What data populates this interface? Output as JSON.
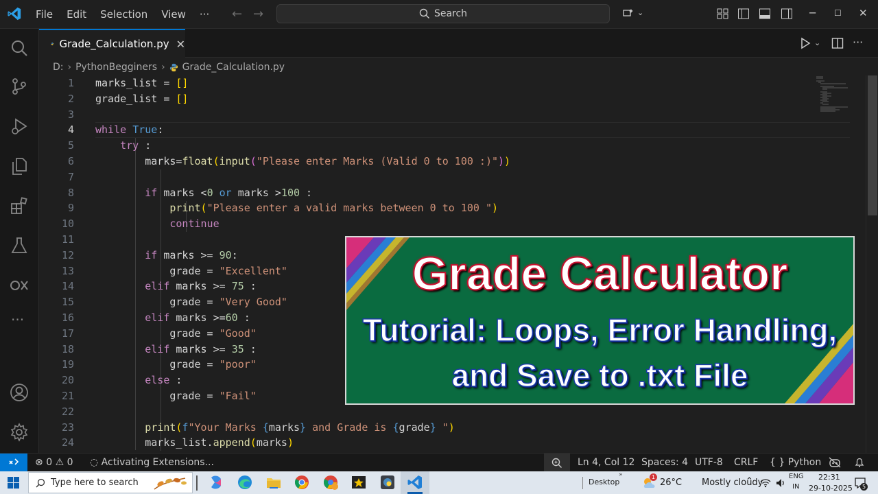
{
  "titlebar": {
    "menu": [
      "File",
      "Edit",
      "Selection",
      "View",
      "···"
    ],
    "search_label": "Search"
  },
  "tab": {
    "filename": "Grade_Calculation.py",
    "close_glyph": "✕"
  },
  "breadcrumb": [
    "D:",
    "PythonBegginers",
    "Grade_Calculation.py"
  ],
  "editor": {
    "current_line": 4,
    "lines": [
      {
        "no": "1",
        "html": "<span class=\"v\">marks_list = </span><span class=\"y\">[]</span>"
      },
      {
        "no": "2",
        "html": "<span class=\"v\">grade_list = </span><span class=\"y\">[]</span>"
      },
      {
        "no": "3",
        "html": ""
      },
      {
        "no": "4",
        "html": "<span class=\"k\">while</span> <span class=\"b\">True</span><span class=\"v\">:</span>"
      },
      {
        "no": "5",
        "html": "    <span class=\"k\">try</span><span class=\"v\"> :</span>"
      },
      {
        "no": "6",
        "html": "        <span class=\"v\">marks=</span><span class=\"f\">float</span><span class=\"y\">(</span><span class=\"f\">input</span><span class=\"p\">(</span><span class=\"s\">\"Please enter Marks (Valid 0 to 100 :)\"</span><span class=\"p\">)</span><span class=\"y\">)</span>"
      },
      {
        "no": "7",
        "html": ""
      },
      {
        "no": "8",
        "html": "        <span class=\"k\">if</span><span class=\"v\"> marks &lt;</span><span class=\"n\">0</span> <span class=\"b\">or</span><span class=\"v\"> marks &gt;</span><span class=\"n\">100</span><span class=\"v\"> :</span>"
      },
      {
        "no": "9",
        "html": "            <span class=\"f\">print</span><span class=\"y\">(</span><span class=\"s\">\"Please enter a valid marks between 0 to 100 \"</span><span class=\"y\">)</span>"
      },
      {
        "no": "10",
        "html": "            <span class=\"k\">continue</span>"
      },
      {
        "no": "11",
        "html": ""
      },
      {
        "no": "12",
        "html": "        <span class=\"k\">if</span><span class=\"v\"> marks &gt;= </span><span class=\"n\">90</span><span class=\"v\">:</span>"
      },
      {
        "no": "13",
        "html": "            <span class=\"v\">grade = </span><span class=\"s\">\"Excellent\"</span>"
      },
      {
        "no": "14",
        "html": "        <span class=\"k\">elif</span><span class=\"v\"> marks &gt;= </span><span class=\"n\">75</span><span class=\"v\"> :</span>"
      },
      {
        "no": "15",
        "html": "            <span class=\"v\">grade = </span><span class=\"s\">\"Very Good\"</span>"
      },
      {
        "no": "16",
        "html": "        <span class=\"k\">elif</span><span class=\"v\"> marks &gt;=</span><span class=\"n\">60</span><span class=\"v\"> :</span>"
      },
      {
        "no": "17",
        "html": "            <span class=\"v\">grade = </span><span class=\"s\">\"Good\"</span>"
      },
      {
        "no": "18",
        "html": "        <span class=\"k\">elif</span><span class=\"v\"> marks &gt;= </span><span class=\"n\">35</span><span class=\"v\"> :</span>"
      },
      {
        "no": "19",
        "html": "            <span class=\"v\">grade = </span><span class=\"s\">\"poor\"</span>"
      },
      {
        "no": "20",
        "html": "        <span class=\"k\">else</span><span class=\"v\"> :</span>"
      },
      {
        "no": "21",
        "html": "            <span class=\"v\">grade = </span><span class=\"s\">\"Fail\"</span>"
      },
      {
        "no": "22",
        "html": ""
      },
      {
        "no": "23",
        "html": "        <span class=\"f\">print</span><span class=\"y\">(</span><span class=\"b\">f</span><span class=\"s\">\"Your Marks </span><span class=\"b\">{</span><span class=\"v\">marks</span><span class=\"b\">}</span><span class=\"s\"> and Grade is </span><span class=\"b\">{</span><span class=\"v\">grade</span><span class=\"b\">}</span><span class=\"s\"> \"</span><span class=\"y\">)</span>"
      },
      {
        "no": "24",
        "html": "        <span class=\"v\">marks_list.</span><span class=\"f\">append</span><span class=\"y\">(</span><span class=\"v\">marks</span><span class=\"y\">)</span>"
      }
    ]
  },
  "banner": {
    "title": "Grade Calculator",
    "subtitle_line1": "Tutorial: Loops, Error Handling,",
    "subtitle_line2": "and Save to .txt File"
  },
  "statusbar": {
    "errors": "0",
    "warnings": "0",
    "activity": "Activating Extensions...",
    "position": "Ln 4, Col 12",
    "spaces": "Spaces: 4",
    "encoding": "UTF-8",
    "eol": "CRLF",
    "language": "Python"
  },
  "taskbar": {
    "search_placeholder": "Type here to search",
    "desktop_label": "Desktop",
    "weather_temp": "26°C",
    "weather_desc": "Mostly cloudy",
    "weather_badge": "1",
    "lang_top": "ENG",
    "lang_bottom": "IN",
    "time": "22:31",
    "date": "29-10-2025",
    "notification_count": "5"
  },
  "colors": {
    "accent": "#0078d4",
    "banner_bg": "#0a6b40",
    "title_outline": "#c8102e",
    "subtitle_outline": "#1a3aa8"
  }
}
